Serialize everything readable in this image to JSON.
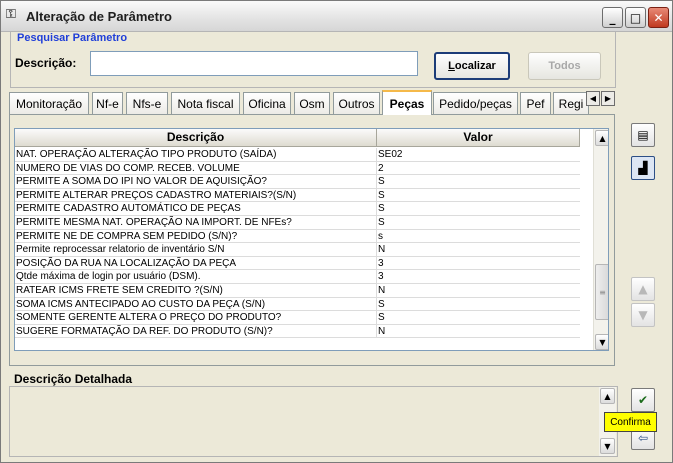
{
  "window": {
    "title": "Alteração de Parâmetro",
    "title_icon": "key-icon",
    "controls": {
      "minimize": "_",
      "maximize": "□",
      "close": "✕"
    }
  },
  "search": {
    "group_title": "Pesquisar Parâmetro",
    "label": "Descrição:",
    "value": "",
    "localizar_label_underlined": "L",
    "localizar_label_rest": "ocalizar",
    "todos_label": "Todos"
  },
  "tabs": [
    {
      "label": "Monitoração"
    },
    {
      "label": "Nf-e"
    },
    {
      "label": "Nfs-e"
    },
    {
      "label": "Nota fiscal"
    },
    {
      "label": "Oficina"
    },
    {
      "label": "Osm"
    },
    {
      "label": "Outros"
    },
    {
      "label": "Peças",
      "active": true
    },
    {
      "label": "Pedido/peças"
    },
    {
      "label": "Pef"
    },
    {
      "label": "Regi"
    }
  ],
  "grid": {
    "headers": {
      "description": "Descrição",
      "value": "Valor"
    },
    "rows": [
      {
        "description": "NAT. OPERAÇÃO ALTERAÇÃO TIPO PRODUTO (SAÍDA)",
        "value": "SE02"
      },
      {
        "description": "NUMERO DE VIAS DO COMP. RECEB. VOLUME",
        "value": "2"
      },
      {
        "description": "PERMITE A SOMA DO IPI NO VALOR DE AQUISIÇÃO?",
        "value": "S"
      },
      {
        "description": "PERMITE ALTERAR PREÇOS CADASTRO MATERIAIS?(S/N)",
        "value": "S"
      },
      {
        "description": "PERMITE CADASTRO AUTOMÁTICO DE PEÇAS",
        "value": "S"
      },
      {
        "description": "PERMITE MESMA NAT. OPERAÇÃO NA IMPORT. DE NFEs?",
        "value": "S"
      },
      {
        "description": "PERMITE NE DE COMPRA SEM PEDIDO (S/N)?",
        "value": "s"
      },
      {
        "description": "Permite reprocessar relatorio de inventário S/N",
        "value": "N"
      },
      {
        "description": "POSIÇÃO DA RUA NA LOCALIZAÇÃO DA PEÇA",
        "value": "3"
      },
      {
        "description": "Qtde máxima de login por usuário (DSM).",
        "value": "3"
      },
      {
        "description": "RATEAR ICMS FRETE SEM CREDITO ?(S/N)",
        "value": "N"
      },
      {
        "description": "SOMA ICMS ANTECIPADO AO CUSTO DA PEÇA (S/N)",
        "value": "S"
      },
      {
        "description": "SOMENTE GERENTE ALTERA O PREÇO DO PRODUTO?",
        "value": "S"
      },
      {
        "description": "SUGERE FORMATAÇÃO DA REF. DO PRODUTO (S/N)?",
        "value": "N"
      }
    ]
  },
  "detail": {
    "label": "Descrição Detalhada"
  },
  "tooltip": {
    "text": "Confirma"
  }
}
